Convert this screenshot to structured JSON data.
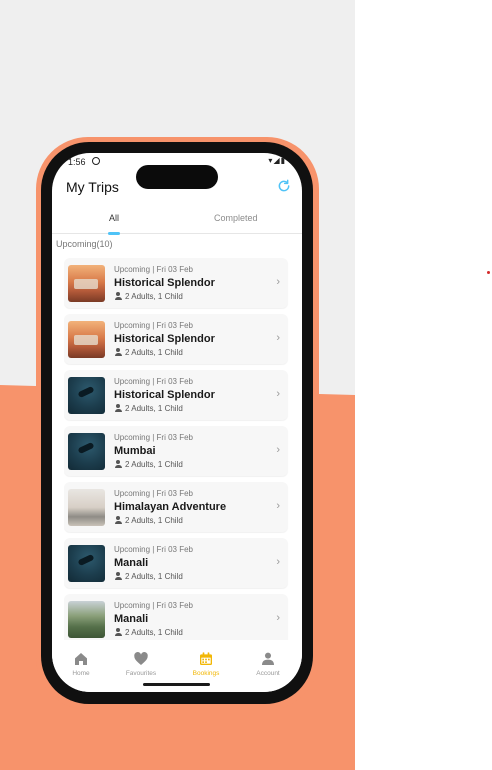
{
  "status_bar": {
    "time": "1:56",
    "icons": "▾◢▮"
  },
  "header": {
    "title": "My Trips",
    "refresh_icon": "refresh-icon",
    "accent": "#4fc3f7"
  },
  "tabs": [
    {
      "label": "All",
      "active": true
    },
    {
      "label": "Completed",
      "active": false
    }
  ],
  "section": {
    "label": "Upcoming(10)"
  },
  "trips": [
    {
      "status": "Upcoming | Fri 03 Feb",
      "name": "Historical Splendor",
      "guests": "2 Adults, 1 Child",
      "image": "fort"
    },
    {
      "status": "Upcoming | Fri 03 Feb",
      "name": "Historical Splendor",
      "guests": "2 Adults, 1 Child",
      "image": "fort"
    },
    {
      "status": "Upcoming | Fri 03 Feb",
      "name": "Historical Splendor",
      "guests": "2 Adults, 1 Child",
      "image": "diver"
    },
    {
      "status": "Upcoming | Fri 03 Feb",
      "name": "Mumbai",
      "guests": "2 Adults, 1 Child",
      "image": "diver"
    },
    {
      "status": "Upcoming | Fri 03 Feb",
      "name": "Himalayan Adventure",
      "guests": "2 Adults, 1 Child",
      "image": "beach"
    },
    {
      "status": "Upcoming | Fri 03 Feb",
      "name": "Manali",
      "guests": "2 Adults, 1 Child",
      "image": "diver"
    },
    {
      "status": "Upcoming | Fri 03 Feb",
      "name": "Manali",
      "guests": "2 Adults, 1 Child",
      "image": "hills"
    }
  ],
  "bottom_nav": [
    {
      "label": "Home",
      "icon": "home-icon",
      "active": false
    },
    {
      "label": "Favourites",
      "icon": "heart-icon",
      "active": false
    },
    {
      "label": "Bookings",
      "icon": "calendar-icon",
      "active": true
    },
    {
      "label": "Account",
      "icon": "person-icon",
      "active": false
    }
  ],
  "colors": {
    "brand_orange": "#f7936b",
    "active_nav": "#f2b705",
    "background_gray": "#efefef"
  }
}
